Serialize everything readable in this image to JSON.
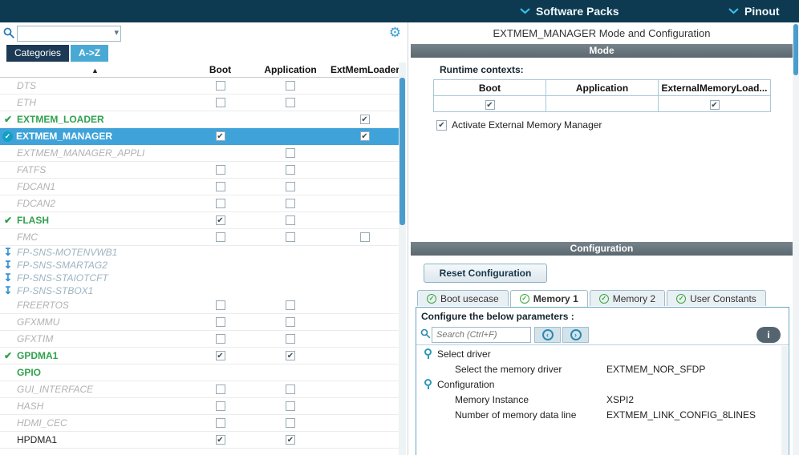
{
  "topbar": {
    "items": [
      {
        "label": "Software Packs"
      },
      {
        "label": "Pinout"
      }
    ]
  },
  "left_panel": {
    "search": {
      "value": "",
      "placeholder": ""
    },
    "tabs": [
      {
        "label": "Categories",
        "active": false
      },
      {
        "label": "A->Z",
        "active": true
      }
    ],
    "table": {
      "sort_icon": "▲",
      "columns": [
        "Boot",
        "Application",
        "ExtMemLoader"
      ],
      "rows": [
        {
          "name": "DTS",
          "style": "disabled",
          "icon": "none",
          "boot": "empty",
          "app": "empty",
          "ext": "none"
        },
        {
          "name": "ETH",
          "style": "disabled",
          "icon": "none",
          "boot": "empty",
          "app": "empty",
          "ext": "none"
        },
        {
          "name": "EXTMEM_LOADER",
          "style": "green",
          "icon": "check",
          "boot": "none",
          "app": "none",
          "ext": "checked"
        },
        {
          "name": "EXTMEM_MANAGER",
          "style": "selected",
          "icon": "circle-check",
          "boot": "checked",
          "app": "none",
          "ext": "checked"
        },
        {
          "name": "EXTMEM_MANAGER_APPLI",
          "style": "disabled",
          "icon": "none",
          "boot": "none",
          "app": "empty",
          "ext": "none"
        },
        {
          "name": "FATFS",
          "style": "disabled",
          "icon": "none",
          "boot": "empty",
          "app": "empty",
          "ext": "none"
        },
        {
          "name": "FDCAN1",
          "style": "disabled",
          "icon": "none",
          "boot": "empty",
          "app": "empty",
          "ext": "none"
        },
        {
          "name": "FDCAN2",
          "style": "disabled",
          "icon": "none",
          "boot": "empty",
          "app": "empty",
          "ext": "none"
        },
        {
          "name": "FLASH",
          "style": "green",
          "icon": "check",
          "boot": "checked",
          "app": "empty",
          "ext": "none"
        },
        {
          "name": "FMC",
          "style": "disabled",
          "icon": "none",
          "boot": "empty",
          "app": "empty",
          "ext": "empty"
        },
        {
          "name": "FP-SNS-MOTENVWB1",
          "style": "pack",
          "icon": "download",
          "boot": "none",
          "app": "none",
          "ext": "none"
        },
        {
          "name": "FP-SNS-SMARTAG2",
          "style": "pack",
          "icon": "download",
          "boot": "none",
          "app": "none",
          "ext": "none"
        },
        {
          "name": "FP-SNS-STAIOTCFT",
          "style": "pack",
          "icon": "download",
          "boot": "none",
          "app": "none",
          "ext": "none"
        },
        {
          "name": "FP-SNS-STBOX1",
          "style": "pack",
          "icon": "download",
          "boot": "none",
          "app": "none",
          "ext": "none"
        },
        {
          "name": "FREERTOS",
          "style": "disabled",
          "icon": "none",
          "boot": "empty",
          "app": "empty",
          "ext": "none"
        },
        {
          "name": "GFXMMU",
          "style": "disabled",
          "icon": "none",
          "boot": "empty",
          "app": "empty",
          "ext": "none"
        },
        {
          "name": "GFXTIM",
          "style": "disabled",
          "icon": "none",
          "boot": "empty",
          "app": "empty",
          "ext": "none"
        },
        {
          "name": "GPDMA1",
          "style": "green",
          "icon": "check",
          "boot": "checked",
          "app": "checked",
          "ext": "none"
        },
        {
          "name": "GPIO",
          "style": "green",
          "icon": "none",
          "boot": "none",
          "app": "none",
          "ext": "none"
        },
        {
          "name": "GUI_INTERFACE",
          "style": "disabled",
          "icon": "none",
          "boot": "empty",
          "app": "empty",
          "ext": "none"
        },
        {
          "name": "HASH",
          "style": "disabled",
          "icon": "none",
          "boot": "empty",
          "app": "empty",
          "ext": "none"
        },
        {
          "name": "HDMI_CEC",
          "style": "disabled",
          "icon": "none",
          "boot": "empty",
          "app": "empty",
          "ext": "none"
        },
        {
          "name": "HPDMA1",
          "style": "normal",
          "icon": "none",
          "boot": "checked",
          "app": "checked",
          "ext": "none"
        }
      ]
    }
  },
  "right_panel": {
    "title": "EXTMEM_MANAGER Mode and Configuration",
    "mode_section": {
      "header": "Mode",
      "runtime_contexts_label": "Runtime contexts:",
      "table": {
        "headers": [
          "Boot",
          "Application",
          "ExternalMemoryLoad..."
        ],
        "cells": [
          "checked",
          "none",
          "checked"
        ]
      },
      "activate_checkbox": {
        "label": "Activate External Memory Manager",
        "checked": true
      }
    },
    "config_section": {
      "header": "Configuration",
      "reset_button_label": "Reset Configuration",
      "tabs": [
        {
          "label": "Boot usecase",
          "active": false
        },
        {
          "label": "Memory 1",
          "active": true
        },
        {
          "label": "Memory 2",
          "active": false
        },
        {
          "label": "User Constants",
          "active": false
        }
      ],
      "params_label": "Configure the below parameters :",
      "search": {
        "value": "",
        "placeholder": "Search (Ctrl+F)"
      },
      "info_button_label": "i",
      "tree": [
        {
          "type": "group",
          "label": "Select driver"
        },
        {
          "type": "param",
          "label": "Select the memory driver",
          "value": "EXTMEM_NOR_SFDP"
        },
        {
          "type": "group",
          "label": "Configuration"
        },
        {
          "type": "param",
          "label": "Memory Instance",
          "value": "XSPI2"
        },
        {
          "type": "param",
          "label": "Number of memory data line",
          "value": "EXTMEM_LINK_CONFIG_8LINES"
        }
      ]
    }
  },
  "colors": {
    "topbar_bg": "#0d3a50",
    "accent_cyan": "#38c6ea",
    "selected_row": "#3fa3d9",
    "enabled_green": "#2fa14e",
    "section_header_gray": "#68757d",
    "scrollbar_thumb": "#4a9ccc"
  }
}
